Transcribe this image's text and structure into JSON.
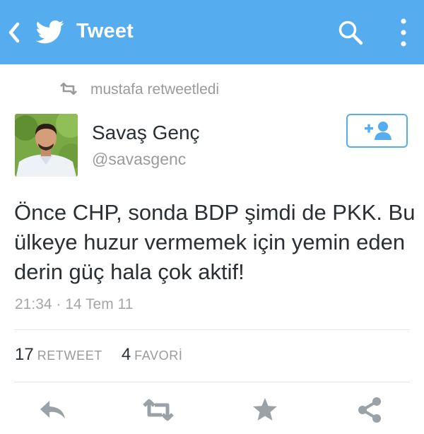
{
  "header": {
    "title": "Tweet",
    "color": "#55acee",
    "icons": [
      "back-arrow-icon",
      "twitter-bird-icon",
      "search-icon",
      "more-vertical-icon"
    ]
  },
  "retweet_context": {
    "text": "mustafa retweetledi",
    "icon": "retweet-icon"
  },
  "author": {
    "name": "Savaş Genç",
    "handle": "@savasgenc",
    "follow_icon": "follow-user-icon"
  },
  "tweet": {
    "text": "Önce CHP, sonda BDP şimdi de PKK. Bu ülkeye huzur vermemek için yemin eden derin güç hala çok aktif!",
    "timestamp": "21:34 · 14 Tem 11"
  },
  "stats": {
    "retweets_count": "17",
    "retweets_label": "RETWEET",
    "favorites_count": "4",
    "favorites_label": "FAVORİ"
  },
  "actions": [
    "reply-icon",
    "retweet-icon",
    "favorite-star-icon",
    "share-icon"
  ]
}
